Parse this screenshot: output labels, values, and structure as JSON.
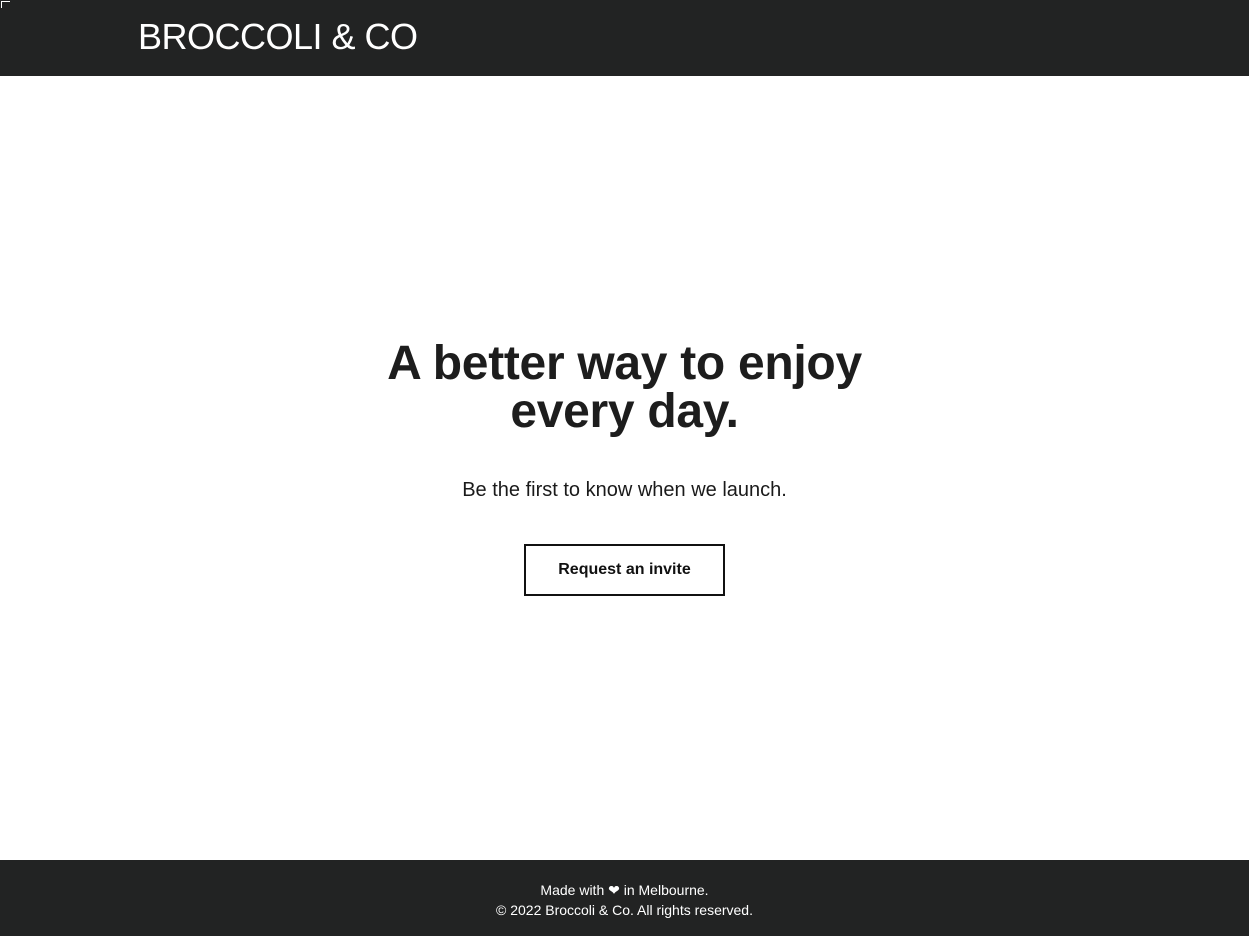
{
  "header": {
    "brand": "BROCCOLI & CO"
  },
  "hero": {
    "headline_line1": "A better way to enjoy",
    "headline_line2": "every day.",
    "subline": "Be the first to know when we launch.",
    "cta_label": "Request an invite"
  },
  "footer": {
    "made_with": "Made with ❤ in Melbourne.",
    "copyright": "© 2022 Broccoli & Co. All rights reserved."
  },
  "colors": {
    "header_bg": "#222323",
    "footer_bg": "#222323",
    "text_dark": "#1d1d1d",
    "page_bg": "#ffffff"
  }
}
